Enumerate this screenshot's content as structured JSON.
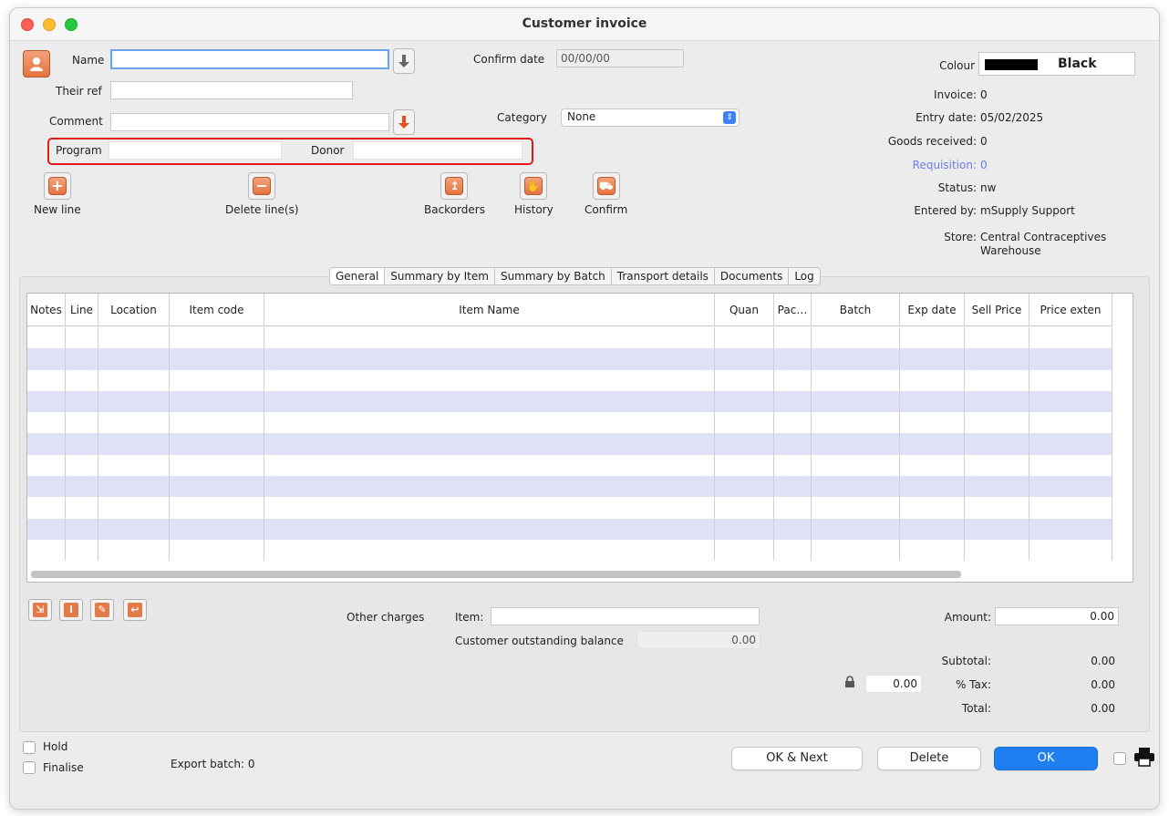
{
  "window": {
    "title": "Customer invoice"
  },
  "header": {
    "name_label": "Name",
    "name_value": "",
    "their_ref_label": "Their ref",
    "their_ref_value": "",
    "comment_label": "Comment",
    "comment_value": "",
    "program_label": "Program",
    "program_value": "",
    "donor_label": "Donor",
    "donor_value": "",
    "confirm_date_label": "Confirm date",
    "confirm_date_value": "00/00/00",
    "category_label": "Category",
    "category_value": "None"
  },
  "toolbar": {
    "new_line": "New line",
    "delete_lines": "Delete line(s)",
    "backorders": "Backorders",
    "history": "History",
    "confirm": "Confirm"
  },
  "info": {
    "colour_label": "Colour",
    "colour_value": "Black",
    "colour_hex": "#000000",
    "invoice_label": "Invoice:",
    "invoice_value": "0",
    "entry_date_label": "Entry date:",
    "entry_date_value": "05/02/2025",
    "goods_received_label": "Goods received:",
    "goods_received_value": "0",
    "requisition_label": "Requisition:",
    "requisition_value": "0",
    "status_label": "Status:",
    "status_value": "nw",
    "entered_by_label": "Entered by:",
    "entered_by_value": "mSupply Support",
    "store_label": "Store:",
    "store_value_line1": "Central Contraceptives",
    "store_value_line2": "Warehouse"
  },
  "tabs": [
    "General",
    "Summary by Item",
    "Summary by Batch",
    "Transport details",
    "Documents",
    "Log"
  ],
  "table": {
    "columns": [
      "Notes",
      "Line",
      "Location",
      "Item code",
      "Item Name",
      "Quan",
      "Pac…",
      "Batch",
      "Exp date",
      "Sell Price",
      "Price exten"
    ],
    "rows": []
  },
  "footer": {
    "other_charges_label": "Other charges",
    "item_label": "Item:",
    "item_value": "",
    "outstanding_label": "Customer outstanding balance",
    "outstanding_value": "0.00",
    "amount_label": "Amount:",
    "amount_value": "0.00",
    "subtotal_label": "Subtotal:",
    "subtotal_value": "0.00",
    "tax_label": "% Tax:",
    "tax_rate_value": "0.00",
    "tax_value": "0.00",
    "total_label": "Total:",
    "total_value": "0.00",
    "hold_label": "Hold",
    "finalise_label": "Finalise",
    "export_batch_label": "Export batch: 0",
    "ok_next_label": "OK & Next",
    "delete_label": "Delete",
    "ok_label": "OK"
  },
  "colors": {
    "accent": "#1f7ff0",
    "highlight": "#e0191b",
    "row_alt": "#dfe2f7",
    "icon": "#e47a47"
  }
}
